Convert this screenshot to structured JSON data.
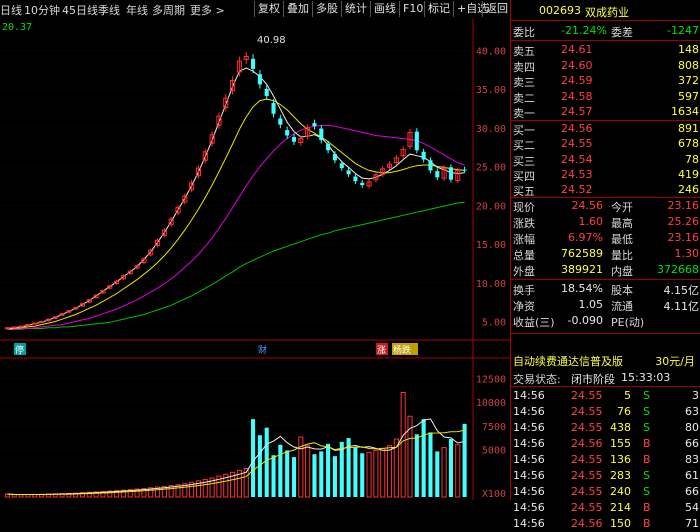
{
  "menu": [
    "日线",
    "10分钟",
    "45日线",
    "季线",
    "年线",
    "多周期",
    "更多 >"
  ],
  "toolbar": [
    "复权",
    "叠加",
    "多股",
    "统计",
    "画线",
    "F10",
    "标记",
    "+自选",
    "返回"
  ],
  "chart_header": {
    "left_value": "20.37"
  },
  "price_axis": [
    "40.00",
    "35.00",
    "30.00",
    "25.00",
    "20.00",
    "15.00",
    "10.00",
    "5.00"
  ],
  "volume_axis": [
    "12500",
    "10000",
    "7500",
    "5000",
    "X100"
  ],
  "annotations": {
    "high": "40.98",
    "event_a": "停",
    "event_b": "财",
    "event_c": "涨",
    "event_d": "杨跌"
  },
  "chart_data": {
    "type": "candlestick",
    "ylim": [
      3,
      43
    ],
    "closes": [
      4.2,
      4.3,
      4.4,
      4.6,
      4.8,
      5.0,
      5.3,
      5.6,
      6.0,
      6.4,
      6.8,
      7.3,
      7.8,
      8.4,
      9.0,
      9.6,
      10.2,
      10.9,
      11.5,
      12.2,
      13.1,
      14.2,
      15.5,
      16.8,
      18.2,
      19.7,
      21.2,
      22.9,
      24.8,
      26.9,
      29.1,
      31.5,
      33.8,
      36.1,
      38.6,
      39.2,
      37.6,
      35.6,
      34.1,
      31.8,
      30.4,
      29.0,
      28.2,
      28.6,
      30.0,
      30.2,
      28.4,
      27.1,
      25.8,
      24.8,
      24.0,
      23.1,
      22.6,
      23.0,
      23.9,
      24.7,
      25.3,
      26.1,
      27.2,
      29.4,
      27.1,
      25.9,
      24.5,
      23.6,
      24.8,
      23.3,
      24.5,
      24.56
    ],
    "opens": [
      4.1,
      4.2,
      4.3,
      4.5,
      4.7,
      4.9,
      5.1,
      5.4,
      5.8,
      6.2,
      6.6,
      7.0,
      7.5,
      8.1,
      8.7,
      9.3,
      9.9,
      10.5,
      11.2,
      11.9,
      12.6,
      13.6,
      14.8,
      16.1,
      17.5,
      19.0,
      20.4,
      22.0,
      23.8,
      25.8,
      28.0,
      30.3,
      32.6,
      34.8,
      37.2,
      38.8,
      38.9,
      36.9,
      35.0,
      33.2,
      31.2,
      29.7,
      28.8,
      28.1,
      28.9,
      30.6,
      29.9,
      27.9,
      26.6,
      25.4,
      24.5,
      23.7,
      22.9,
      22.5,
      23.3,
      24.0,
      24.9,
      25.5,
      26.4,
      27.6,
      29.5,
      26.9,
      25.8,
      24.4,
      23.5,
      24.9,
      23.2,
      24.6
    ],
    "volumes": [
      300,
      250,
      240,
      260,
      270,
      290,
      310,
      330,
      360,
      380,
      420,
      460,
      500,
      540,
      580,
      620,
      680,
      720,
      780,
      840,
      900,
      980,
      1050,
      1120,
      1200,
      1300,
      1400,
      1550,
      1700,
      1850,
      2000,
      2200,
      2400,
      2600,
      2800,
      3000,
      8200,
      6500,
      7300,
      4400,
      5500,
      4900,
      4200,
      6300,
      5400,
      4500,
      4800,
      5600,
      4300,
      5800,
      6200,
      5200,
      4600,
      4700,
      4900,
      5100,
      5400,
      6100,
      11000,
      8500,
      6600,
      8200,
      6800,
      4800,
      5200,
      6100,
      5500,
      7700
    ],
    "ma_white": [
      4.1,
      4.2,
      4.3,
      4.5,
      4.7,
      4.9,
      5.2,
      5.5,
      5.9,
      6.3,
      6.7,
      7.2,
      7.7,
      8.3,
      8.9,
      9.5,
      10.1,
      10.8,
      11.4,
      12.1,
      13.0,
      14.0,
      15.2,
      16.5,
      17.9,
      19.4,
      20.9,
      22.5,
      24.3,
      26.3,
      28.4,
      30.7,
      33.0,
      35.3,
      37.3,
      37.7,
      37.3,
      36.6,
      35.6,
      34.1,
      32.4,
      30.7,
      29.5,
      28.8,
      28.9,
      29.1,
      28.7,
      27.8,
      26.6,
      25.6,
      24.9,
      24.1,
      23.5,
      23.4,
      23.6,
      24.0,
      24.5,
      25.1,
      25.9,
      26.6,
      26.4,
      26.2,
      25.6,
      24.9,
      24.6,
      24.2,
      24.1,
      24.2
    ],
    "ma_yellow": [
      4.0,
      4.1,
      4.2,
      4.3,
      4.4,
      4.6,
      4.8,
      5.0,
      5.3,
      5.6,
      5.9,
      6.3,
      6.7,
      7.1,
      7.6,
      8.1,
      8.6,
      9.2,
      9.8,
      10.4,
      11.1,
      11.8,
      12.6,
      13.5,
      14.5,
      15.6,
      16.8,
      18.1,
      19.5,
      21.0,
      22.6,
      24.3,
      26.1,
      27.9,
      29.8,
      31.4,
      32.7,
      33.5,
      33.7,
      33.5,
      33.0,
      32.3,
      31.4,
      30.5,
      29.8,
      29.3,
      28.8,
      28.2,
      27.5,
      26.8,
      26.1,
      25.4,
      24.9,
      24.5,
      24.3,
      24.2,
      24.2,
      24.4,
      24.6,
      24.9,
      25.1,
      25.2,
      25.2,
      25.0,
      24.9,
      24.7,
      24.6,
      24.5
    ],
    "ma_magenta": [
      4.0,
      4.0,
      4.1,
      4.1,
      4.2,
      4.3,
      4.4,
      4.5,
      4.6,
      4.8,
      5.0,
      5.2,
      5.4,
      5.7,
      6.0,
      6.3,
      6.6,
      7.0,
      7.4,
      7.8,
      8.3,
      8.8,
      9.3,
      9.9,
      10.5,
      11.2,
      12.0,
      12.8,
      13.7,
      14.7,
      15.8,
      17.0,
      18.3,
      19.7,
      21.1,
      22.5,
      23.8,
      25.0,
      26.0,
      27.0,
      27.9,
      28.6,
      29.2,
      29.7,
      30.0,
      30.2,
      30.3,
      30.3,
      30.2,
      30.0,
      29.8,
      29.6,
      29.4,
      29.2,
      29.0,
      28.9,
      28.8,
      28.7,
      28.6,
      28.5,
      28.3,
      28.0,
      27.5,
      27.0,
      26.5,
      26.0,
      25.5,
      25.2
    ],
    "ma_green": [
      4.0,
      4.0,
      4.0,
      4.1,
      4.1,
      4.1,
      4.2,
      4.2,
      4.3,
      4.3,
      4.4,
      4.5,
      4.6,
      4.7,
      4.8,
      4.9,
      5.1,
      5.3,
      5.5,
      5.7,
      5.9,
      6.2,
      6.5,
      6.8,
      7.1,
      7.5,
      7.9,
      8.3,
      8.8,
      9.3,
      9.8,
      10.3,
      10.9,
      11.4,
      12.0,
      12.5,
      12.9,
      13.3,
      13.7,
      14.1,
      14.4,
      14.7,
      15.0,
      15.3,
      15.6,
      15.9,
      16.2,
      16.4,
      16.7,
      16.9,
      17.1,
      17.3,
      17.5,
      17.7,
      17.9,
      18.1,
      18.3,
      18.5,
      18.7,
      18.9,
      19.1,
      19.3,
      19.5,
      19.7,
      19.9,
      20.1,
      20.3,
      20.4
    ]
  },
  "quote": {
    "code": "002693",
    "name": "双成药业",
    "weibi_label": "委比",
    "weibi": "-21.24%",
    "weicha_label": "委差",
    "weicha": "-1247",
    "asks": [
      {
        "label": "卖五",
        "price": "24.61",
        "vol": "148"
      },
      {
        "label": "卖四",
        "price": "24.60",
        "vol": "808"
      },
      {
        "label": "卖三",
        "price": "24.59",
        "vol": "372"
      },
      {
        "label": "卖二",
        "price": "24.58",
        "vol": "597"
      },
      {
        "label": "卖一",
        "price": "24.57",
        "vol": "1634"
      }
    ],
    "bids": [
      {
        "label": "买一",
        "price": "24.56",
        "vol": "891"
      },
      {
        "label": "买二",
        "price": "24.55",
        "vol": "678"
      },
      {
        "label": "买三",
        "price": "24.54",
        "vol": "78"
      },
      {
        "label": "买四",
        "price": "24.53",
        "vol": "419"
      },
      {
        "label": "买五",
        "price": "24.52",
        "vol": "246"
      }
    ],
    "stats1": [
      {
        "l1": "现价",
        "v1": "24.56",
        "l2": "今开",
        "v2": "23.16"
      },
      {
        "l1": "涨跌",
        "v1": "1.60",
        "l2": "最高",
        "v2": "25.26"
      },
      {
        "l1": "涨幅",
        "v1": "6.97%",
        "l2": "最低",
        "v2": "23.16"
      },
      {
        "l1": "总量",
        "v1": "762589",
        "l2": "量比",
        "v2": "1.30"
      },
      {
        "l1": "外盘",
        "v1": "389921",
        "l2": "内盘",
        "v2": "372668"
      }
    ],
    "stats2": [
      {
        "l1": "换手",
        "v1": "18.54%",
        "l2": "股本",
        "v2": "4.15亿"
      },
      {
        "l1": "净资",
        "v1": "1.05",
        "l2": "流通",
        "v2": "4.11亿"
      },
      {
        "l1": "收益(三)",
        "v1": "-0.090",
        "l2": "PE(动)",
        "v2": ""
      }
    ],
    "ad_text": "自动续费通达信普及版",
    "ad_price": "30元/月",
    "status_label": "交易状态:",
    "status": "闭市阶段",
    "status_time": "15:33:03",
    "ticks": [
      {
        "time": "14:56",
        "price": "24.55",
        "vol": "5",
        "bs": "S",
        "num": "3"
      },
      {
        "time": "14:56",
        "price": "24.55",
        "vol": "76",
        "bs": "S",
        "num": "63"
      },
      {
        "time": "14:56",
        "price": "24.55",
        "vol": "438",
        "bs": "S",
        "num": "80"
      },
      {
        "time": "14:56",
        "price": "24.56",
        "vol": "155",
        "bs": "B",
        "num": "66"
      },
      {
        "time": "14:56",
        "price": "24.55",
        "vol": "136",
        "bs": "B",
        "num": "83"
      },
      {
        "time": "14:56",
        "price": "24.55",
        "vol": "283",
        "bs": "S",
        "num": "61"
      },
      {
        "time": "14:56",
        "price": "24.55",
        "vol": "240",
        "bs": "S",
        "num": "66"
      },
      {
        "time": "14:56",
        "price": "24.55",
        "vol": "214",
        "bs": "B",
        "num": "54"
      },
      {
        "time": "14:56",
        "price": "24.56",
        "vol": "150",
        "bs": "B",
        "num": "71"
      }
    ]
  }
}
